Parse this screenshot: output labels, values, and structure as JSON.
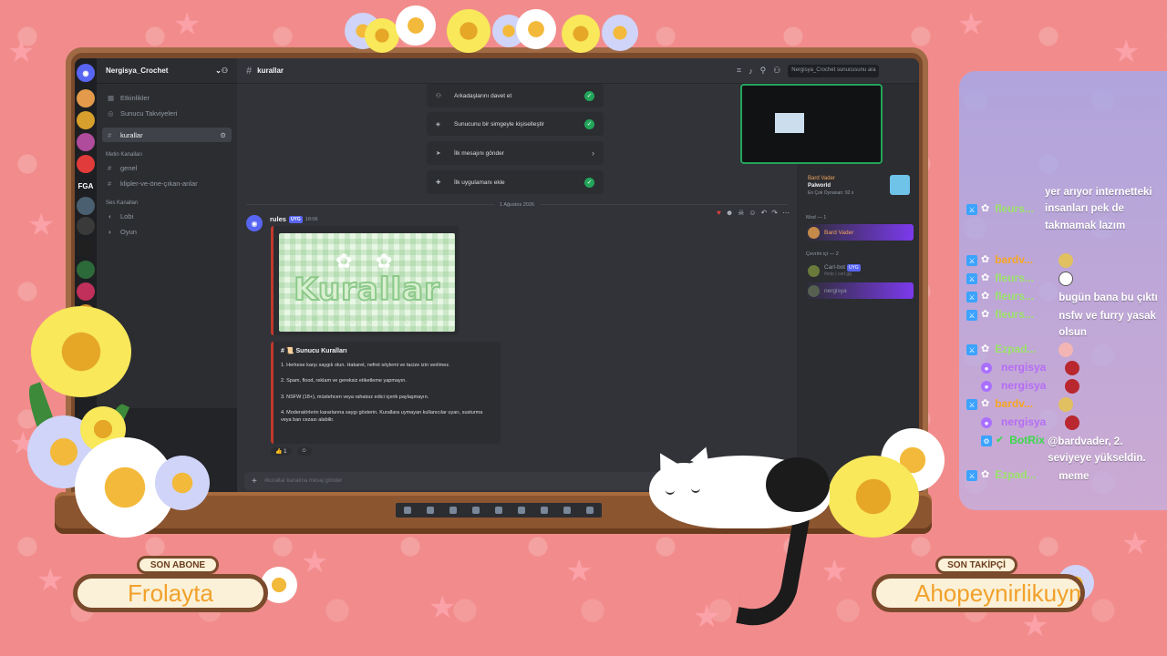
{
  "discord": {
    "server_name": "Nergisya_Crochet",
    "channel_title": "kurallar",
    "search_placeholder": "Nergisya_Crochet sunucusunu ara",
    "nav": [
      {
        "glyph": "▦",
        "label": "Etkinlikler"
      },
      {
        "glyph": "◎",
        "label": "Sunucu Takviyeleri"
      }
    ],
    "active_channel": "kurallar",
    "text_category": "Metin Kanalları",
    "text_channels": [
      "genel",
      "klipler-ve-öne-çıkan-anlar"
    ],
    "voice_category": "Ses Kanalları",
    "voice_channels": [
      "Lobi",
      "Oyun"
    ],
    "server_icons": [
      "FGA"
    ],
    "tasks": [
      {
        "label": "Arkadaşlarını davet et",
        "done": true
      },
      {
        "label": "Sunucunu bir simgeyle kişiselleştir",
        "done": true
      },
      {
        "label": "İlk mesajını gönder",
        "done": false
      },
      {
        "label": "İlk uygulamanı ekle",
        "done": true
      }
    ],
    "date_divider": "1 Ağustos 2026",
    "message": {
      "author": "rules",
      "badge": "UYG",
      "time": "18:06",
      "image_title": "Kurallar",
      "rules_title": "# 📜 Sunucu Kuralları",
      "rules": [
        "1. Herkese karşı saygılı olun. Hakaret, nefret söylemi ve tacize izin verilmez.",
        "2. Spam, flood, reklam ve gereksiz etiketleme yapmayın.",
        "3. NSFW (18+), müstehcen veya rahatsız edici içerik paylaşmayın.",
        "4. Moderatörlerin kararlarına saygı gösterin. Kurallara uymayan kullanıcılar uyarı, susturma veya ban cezası alabilir."
      ],
      "reaction_emoji": "👍",
      "reaction_count": "1"
    },
    "composer_placeholder": "#kurallar kanalına mesaj gönder",
    "members": {
      "playing_name": "Bard Vader",
      "playing_game": "Palworld",
      "playing_sub": "En Çok Oynanan: 92 s",
      "mod_header": "Mod — 1",
      "mod_name": "Bard Vader",
      "online_header": "Çevrim içi — 2",
      "bot_name": "Carl-bot",
      "bot_badge": "UYG",
      "bot_status": "/help | carl.gg",
      "user_name": "nergisya"
    }
  },
  "chat": [
    {
      "user": "",
      "text": "yer arıyor internetteki insanları pek de takmamak lazım",
      "color": "#ffffff",
      "icon": "none"
    },
    {
      "user": "fleurs...",
      "text": "",
      "color": "#9be36b",
      "icon": "mod"
    },
    {
      "user": "bardv...",
      "text": "",
      "color": "#f5a623",
      "icon": "mod",
      "emote": "#e0c060"
    },
    {
      "user": "fleurs...",
      "text": "",
      "color": "#9be36b",
      "icon": "mod",
      "emote": "#ffffff"
    },
    {
      "user": "fleurs...",
      "text": "bugün bana bu çıktı",
      "color": "#9be36b",
      "icon": "mod"
    },
    {
      "user": "fleurs...",
      "text": "nsfw ve furry yasak olsun",
      "color": "#9be36b",
      "icon": "mod"
    },
    {
      "user": "Ezpad...",
      "text": "",
      "color": "#9be36b",
      "icon": "mod",
      "emote": "#f3b4b4"
    },
    {
      "user": "nergisya",
      "text": "",
      "color": "#b56cf5",
      "icon": "broadcaster",
      "emote": "#b8282e"
    },
    {
      "user": "nergisya",
      "text": "",
      "color": "#b56cf5",
      "icon": "broadcaster",
      "emote": "#b8282e"
    },
    {
      "user": "bardv...",
      "text": "",
      "color": "#f5a623",
      "icon": "mod",
      "emote": "#e0c060"
    },
    {
      "user": "nergisya",
      "text": "",
      "color": "#b56cf5",
      "icon": "broadcaster",
      "emote": "#b8282e"
    },
    {
      "user": "BotRix",
      "text": "@bardvader, 2. seviyeye yükseldin.",
      "color": "#3ad94a",
      "icon": "bot"
    },
    {
      "user": "Ezpad...",
      "text": "meme",
      "color": "#9be36b",
      "icon": "mod"
    }
  ],
  "overlay": {
    "sub_label": "SON ABONE",
    "sub_name": "Frolayta",
    "follow_label": "SON TAKİPÇİ",
    "follow_name": "Ahopeynirlikuymak"
  },
  "colors": {
    "background": "#f28c8c",
    "frame": "#7a4a2c",
    "accent": "#5865f2",
    "green": "#23a55a"
  }
}
